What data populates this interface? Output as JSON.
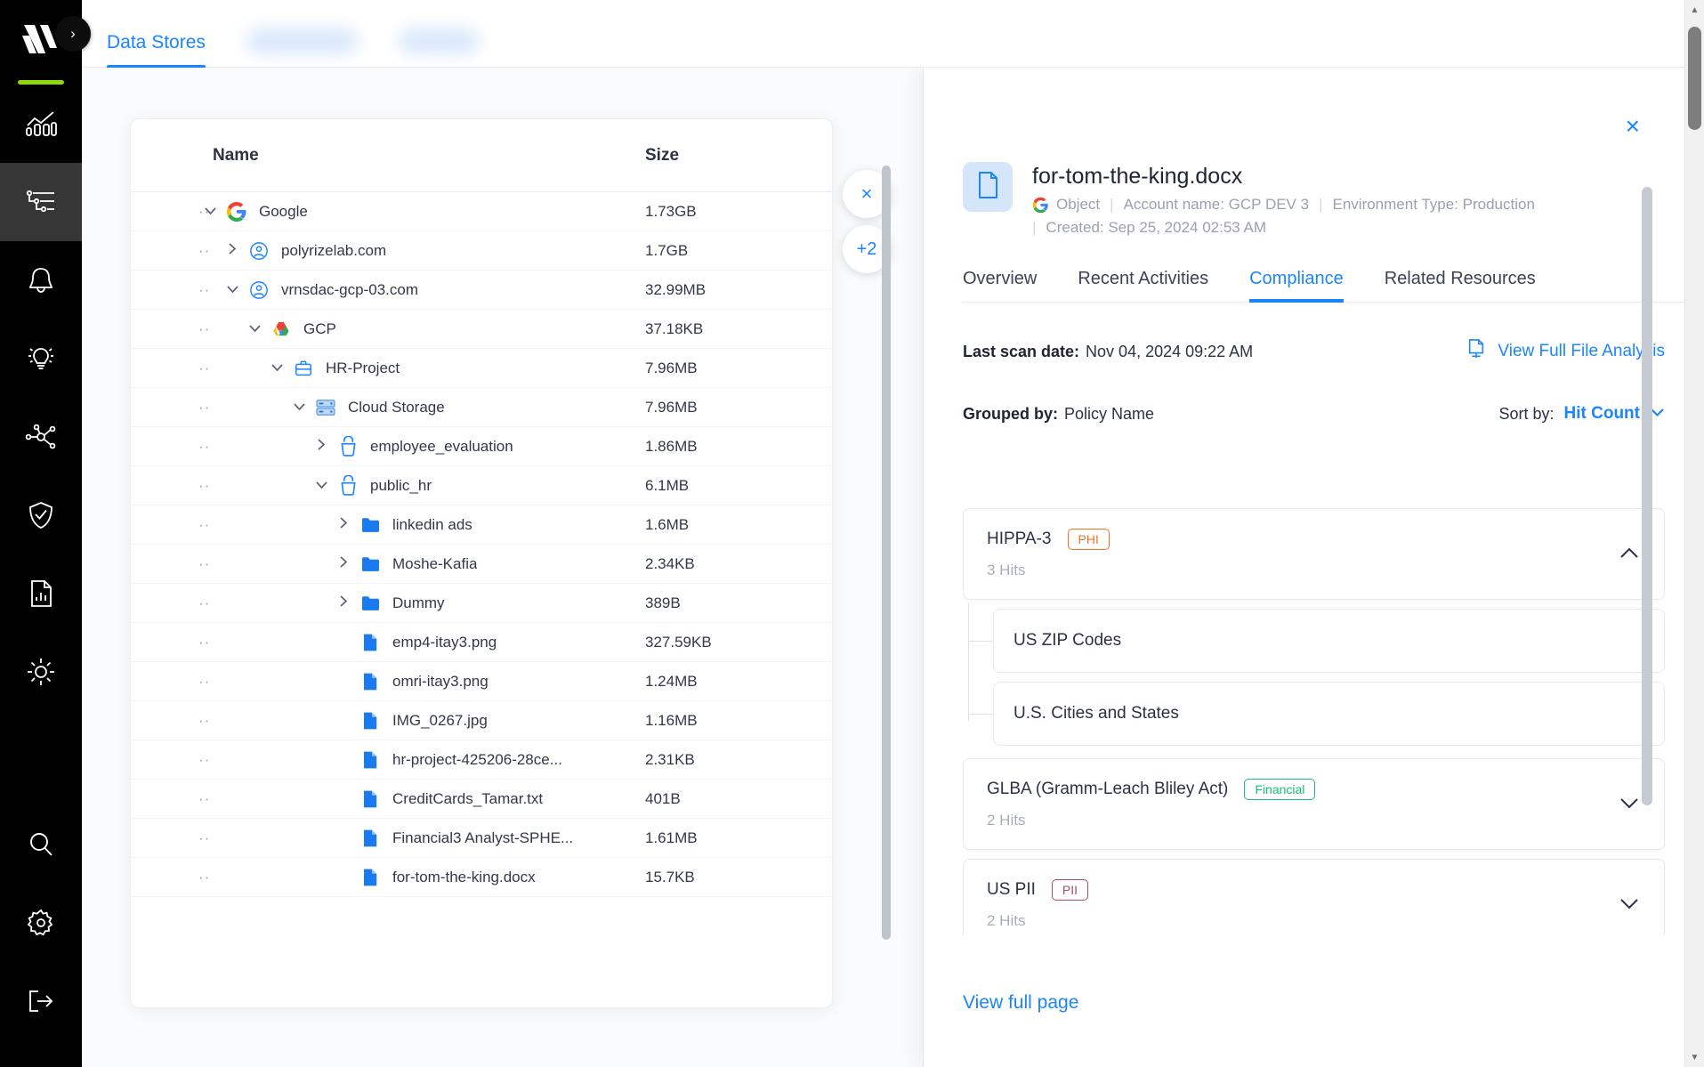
{
  "sidebar": {
    "logo_name": "varonis-logo",
    "accent_color": "#8ed900",
    "collapse_icon": "›",
    "items": [
      {
        "name": "dashboard-analytics",
        "icon": "chart-bars-icon",
        "active": false
      },
      {
        "name": "data-stores",
        "icon": "data-stores-icon",
        "active": true
      },
      {
        "name": "alerts",
        "icon": "bell-icon",
        "active": false
      },
      {
        "name": "insights",
        "icon": "lightbulb-icon",
        "active": false
      },
      {
        "name": "graph",
        "icon": "network-graph-icon",
        "active": false
      },
      {
        "name": "policies",
        "icon": "shield-check-icon",
        "active": false
      },
      {
        "name": "reports",
        "icon": "report-document-icon",
        "active": false
      },
      {
        "name": "theme",
        "icon": "sun-icon",
        "active": false
      }
    ],
    "bottom_items": [
      {
        "name": "search",
        "icon": "search-icon"
      },
      {
        "name": "settings",
        "icon": "gear-icon"
      },
      {
        "name": "logout",
        "icon": "logout-icon"
      }
    ]
  },
  "topbar": {
    "tabs": [
      {
        "label": "Data Stores",
        "active": true,
        "blurred": false
      },
      {
        "label": "",
        "active": false,
        "blurred": true
      },
      {
        "label": "",
        "active": false,
        "blurred": true
      }
    ]
  },
  "tree": {
    "columns": {
      "name": "Name",
      "size": "Size"
    },
    "close_label": "×",
    "more_label": "+2",
    "rows": [
      {
        "indent": 0,
        "chevron": "v",
        "icon": "google-icon",
        "label": "Google",
        "size": "1.73GB"
      },
      {
        "indent": 1,
        "chevron": ">",
        "icon": "account-icon",
        "label": "polyrizelab.com",
        "size": "1.7GB"
      },
      {
        "indent": 1,
        "chevron": "v",
        "icon": "account-icon",
        "label": "vrnsdac-gcp-03.com",
        "size": "32.99MB"
      },
      {
        "indent": 2,
        "chevron": "v",
        "icon": "gcp-icon",
        "label": "GCP",
        "size": "37.18KB"
      },
      {
        "indent": 3,
        "chevron": "v",
        "icon": "project-icon",
        "label": "HR-Project",
        "size": "7.96MB"
      },
      {
        "indent": 4,
        "chevron": "v",
        "icon": "cloud-storage-icon",
        "label": "Cloud Storage",
        "size": "7.96MB"
      },
      {
        "indent": 5,
        "chevron": ">",
        "icon": "bucket-icon",
        "label": "employee_evaluation",
        "size": "1.86MB"
      },
      {
        "indent": 5,
        "chevron": "v",
        "icon": "bucket-icon",
        "label": "public_hr",
        "size": "6.1MB"
      },
      {
        "indent": 6,
        "chevron": ">",
        "icon": "folder-icon",
        "label": "linkedin ads",
        "size": "1.6MB"
      },
      {
        "indent": 6,
        "chevron": ">",
        "icon": "folder-icon",
        "label": "Moshe-Kafia",
        "size": "2.34KB"
      },
      {
        "indent": 6,
        "chevron": ">",
        "icon": "folder-icon",
        "label": "Dummy",
        "size": "389B"
      },
      {
        "indent": 6,
        "chevron": "",
        "icon": "file-icon",
        "label": "emp4-itay3.png",
        "size": "327.59KB"
      },
      {
        "indent": 6,
        "chevron": "",
        "icon": "file-icon",
        "label": "omri-itay3.png",
        "size": "1.24MB"
      },
      {
        "indent": 6,
        "chevron": "",
        "icon": "file-icon",
        "label": "IMG_0267.jpg",
        "size": "1.16MB"
      },
      {
        "indent": 6,
        "chevron": "",
        "icon": "file-icon",
        "label": "hr-project-425206-28ce...",
        "size": "2.31KB"
      },
      {
        "indent": 6,
        "chevron": "",
        "icon": "file-icon",
        "label": "CreditCards_Tamar.txt",
        "size": "401B"
      },
      {
        "indent": 6,
        "chevron": "",
        "icon": "file-icon",
        "label": "Financial3 Analyst-SPHE...",
        "size": "1.61MB"
      },
      {
        "indent": 6,
        "chevron": "",
        "icon": "file-icon",
        "label": "for-tom-the-king.docx",
        "size": "15.7KB"
      }
    ]
  },
  "panel": {
    "close_label": "×",
    "file_icon": "document-icon",
    "title": "for-tom-the-king.docx",
    "provider_icon": "google-icon",
    "object_type": "Object",
    "account_label": "Account name: GCP DEV 3",
    "environment_label": "Environment Type: Production",
    "created_label": "Created: Sep 25, 2024 02:53 AM",
    "separator": "|",
    "tabs": [
      {
        "label": "Overview",
        "active": false
      },
      {
        "label": "Recent Activities",
        "active": false
      },
      {
        "label": "Compliance",
        "active": true
      },
      {
        "label": "Related Resources",
        "active": false
      }
    ],
    "scan": {
      "label": "Last scan date:",
      "value": "Nov 04, 2024 09:22 AM",
      "analysis_link": "View Full File Analysis",
      "analysis_icon": "file-analysis-icon"
    },
    "grouping": {
      "group_label": "Grouped by:",
      "group_value": "Policy Name",
      "sort_label": "Sort by:",
      "sort_value": "Hit Count",
      "sort_chevron": "chevron-down-icon"
    },
    "policies": [
      {
        "name": "HIPPA-3",
        "tag": "PHI",
        "tag_color": "#f2712c",
        "hits": "3 Hits",
        "expanded": true,
        "chevron": "chevron-up-icon",
        "children": [
          "US ZIP Codes",
          "U.S. Cities and States"
        ]
      },
      {
        "name": "GLBA (Gramm-Leach Bliley Act)",
        "tag": "Financial",
        "tag_color": "#18bf78",
        "hits": "2 Hits",
        "expanded": false,
        "chevron": "chevron-down-icon",
        "children": []
      },
      {
        "name": "US PII",
        "tag": "PII",
        "tag_color": "#a4516b",
        "hits": "2 Hits",
        "expanded": false,
        "chevron": "chevron-down-icon",
        "children": []
      }
    ],
    "view_full_page": "View full page"
  },
  "colors": {
    "accent_blue": "#1a85ff",
    "rail_black": "#000000",
    "rail_active": "#363636",
    "green_accent": "#8ed900"
  }
}
